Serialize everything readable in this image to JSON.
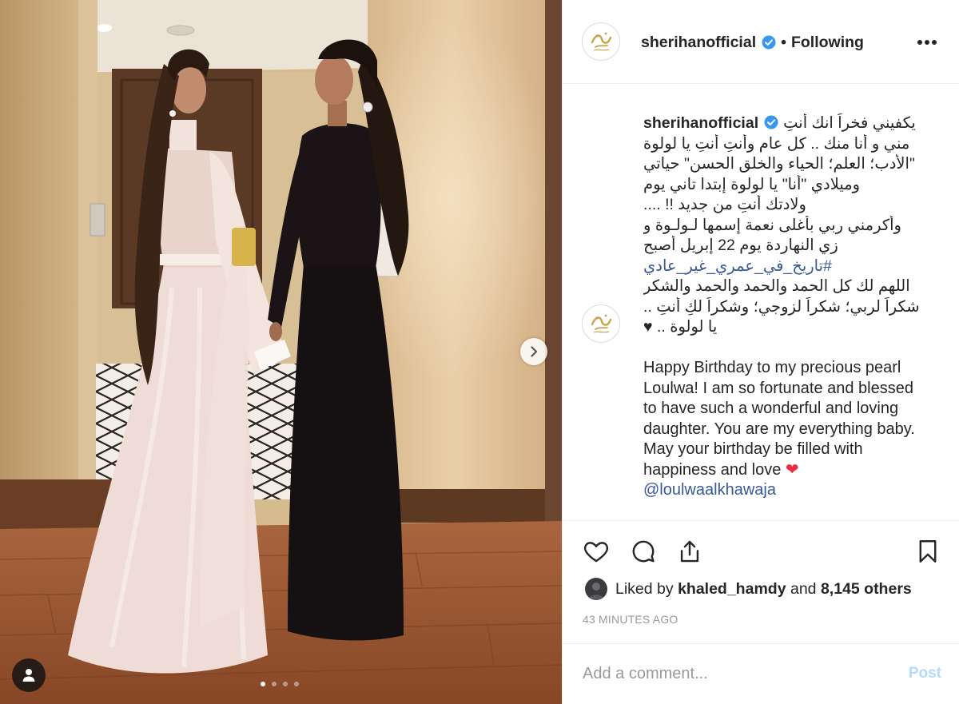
{
  "post": {
    "carousel": {
      "slides": 4,
      "active_index": 0
    },
    "next_icon": "chevron-right-icon",
    "tag_icon": "user-tag-icon"
  },
  "header": {
    "username": "sherihanofficial",
    "verified": true,
    "separator": "•",
    "follow_status": "Following",
    "more_icon": "more-horizontal-icon"
  },
  "caption": {
    "username": "sherihanofficial",
    "first_line": "يكفيني فخراً انك أنتِ",
    "arabic_lines": [
      "مني و أنا منك .. كل عام وأنتِ أنتِ يا لولوة",
      "\"الأدب؛ العلم؛ الحياء والخلق الحسن\" حياتي",
      "وميلادي \"أنا\" يا لولوة إبتدا تاني يوم",
      "ولادتك أنتِ من جديد !! ....",
      "وأكرمني ربي بأغلى نعمة إسمها لـولـوة و",
      "زي النهاردة يوم 22 إبريل أصبح"
    ],
    "hashtag": "#تاريخ_في_عمري_غير_عادي",
    "arabic_closing_lines": [
      "اللهم لك كل الحمد والحمد والحمد والشكر",
      "شكراً لربي؛ شكراً لزوجي؛ وشكراً لكِ أنتِ .."
    ],
    "last_arabic_line": "يا لولوة ..",
    "black_heart": "♥",
    "english_lines": [
      "Happy Birthday to my precious pearl",
      "Loulwa! I am so fortunate and blessed",
      "to have such a wonderful and loving",
      "daughter. You are my everything baby.",
      "May your birthday be filled with"
    ],
    "english_last_line": "happiness and love",
    "red_heart": "❤",
    "mention": "@loulwaalkhawaja"
  },
  "actions": {
    "like_icon": "heart-outline-icon",
    "comment_icon": "comment-icon",
    "share_icon": "share-icon",
    "save_icon": "bookmark-icon"
  },
  "likes": {
    "prefix": "Liked by",
    "user": "khaled_hamdy",
    "middle": "and",
    "others": "8,145 others"
  },
  "timestamp": "43 MINUTES AGO",
  "comment": {
    "placeholder": "Add a comment...",
    "post_label": "Post"
  },
  "colors": {
    "text": "#262626",
    "muted": "#999999",
    "link": "#385898",
    "verified": "#3897f0",
    "post_disabled": "#b3dbff",
    "heart_red": "#ed2c3e",
    "divider": "#efefef"
  }
}
